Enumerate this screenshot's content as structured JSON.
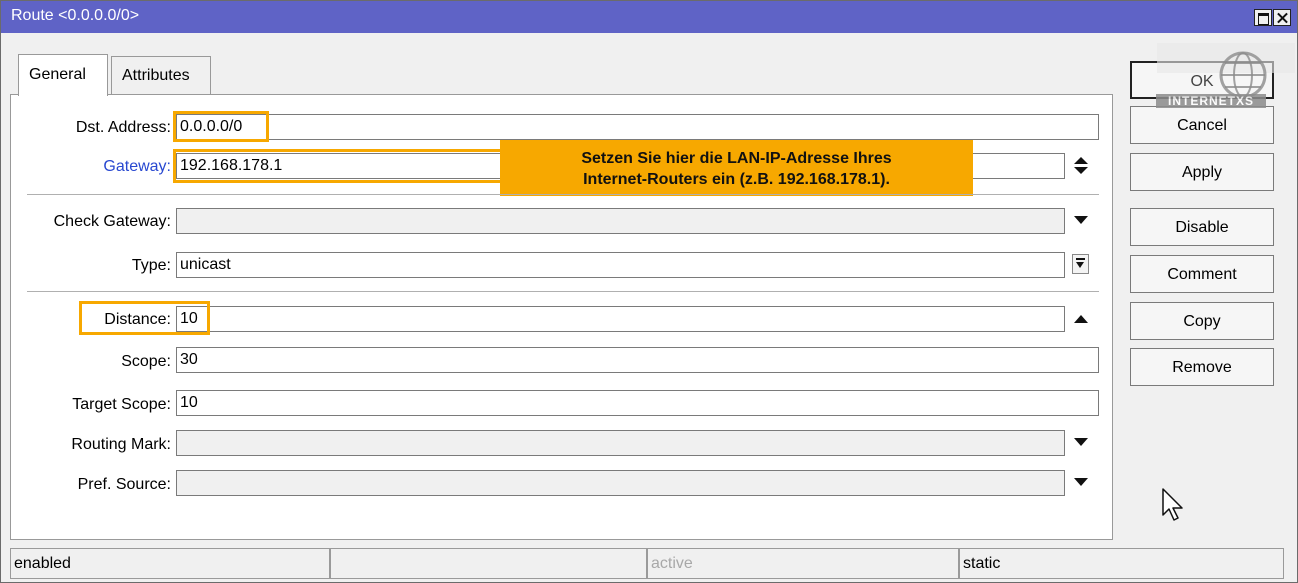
{
  "window": {
    "title": "Route <0.0.0.0/0>"
  },
  "tabs": [
    {
      "label": "General",
      "active": true
    },
    {
      "label": "Attributes",
      "active": false
    }
  ],
  "fields": {
    "dst_address": {
      "label": "Dst. Address:",
      "value": "0.0.0.0/0"
    },
    "gateway": {
      "label": "Gateway:",
      "value": "192.168.178.1"
    },
    "check_gateway": {
      "label": "Check Gateway:",
      "value": ""
    },
    "type": {
      "label": "Type:",
      "value": "unicast"
    },
    "distance": {
      "label": "Distance:",
      "value": "10"
    },
    "scope": {
      "label": "Scope:",
      "value": "30"
    },
    "target_scope": {
      "label": "Target Scope:",
      "value": "10"
    },
    "routing_mark": {
      "label": "Routing Mark:",
      "value": ""
    },
    "pref_source": {
      "label": "Pref. Source:",
      "value": ""
    }
  },
  "callout": {
    "line1": "Setzen Sie hier die LAN-IP-Adresse Ihres",
    "line2": "Internet-Routers ein (z.B. 192.168.178.1)."
  },
  "buttons": {
    "ok": "OK",
    "cancel": "Cancel",
    "apply": "Apply",
    "disable": "Disable",
    "comment": "Comment",
    "copy": "Copy",
    "remove": "Remove"
  },
  "watermark": {
    "text": "INTERNETXS"
  },
  "status": {
    "state": "enabled",
    "middle": "",
    "active": "active",
    "kind": "static"
  },
  "colors": {
    "titlebar": "#5f63c6",
    "highlight": "#f7a800",
    "link": "#2848d0"
  },
  "icons": [
    "maximize-icon",
    "close-icon",
    "updown-icon",
    "dropdown-icon",
    "dropdown-box-icon",
    "arrow-up-icon",
    "mouse-cursor-icon",
    "globe-watermark-icon"
  ]
}
